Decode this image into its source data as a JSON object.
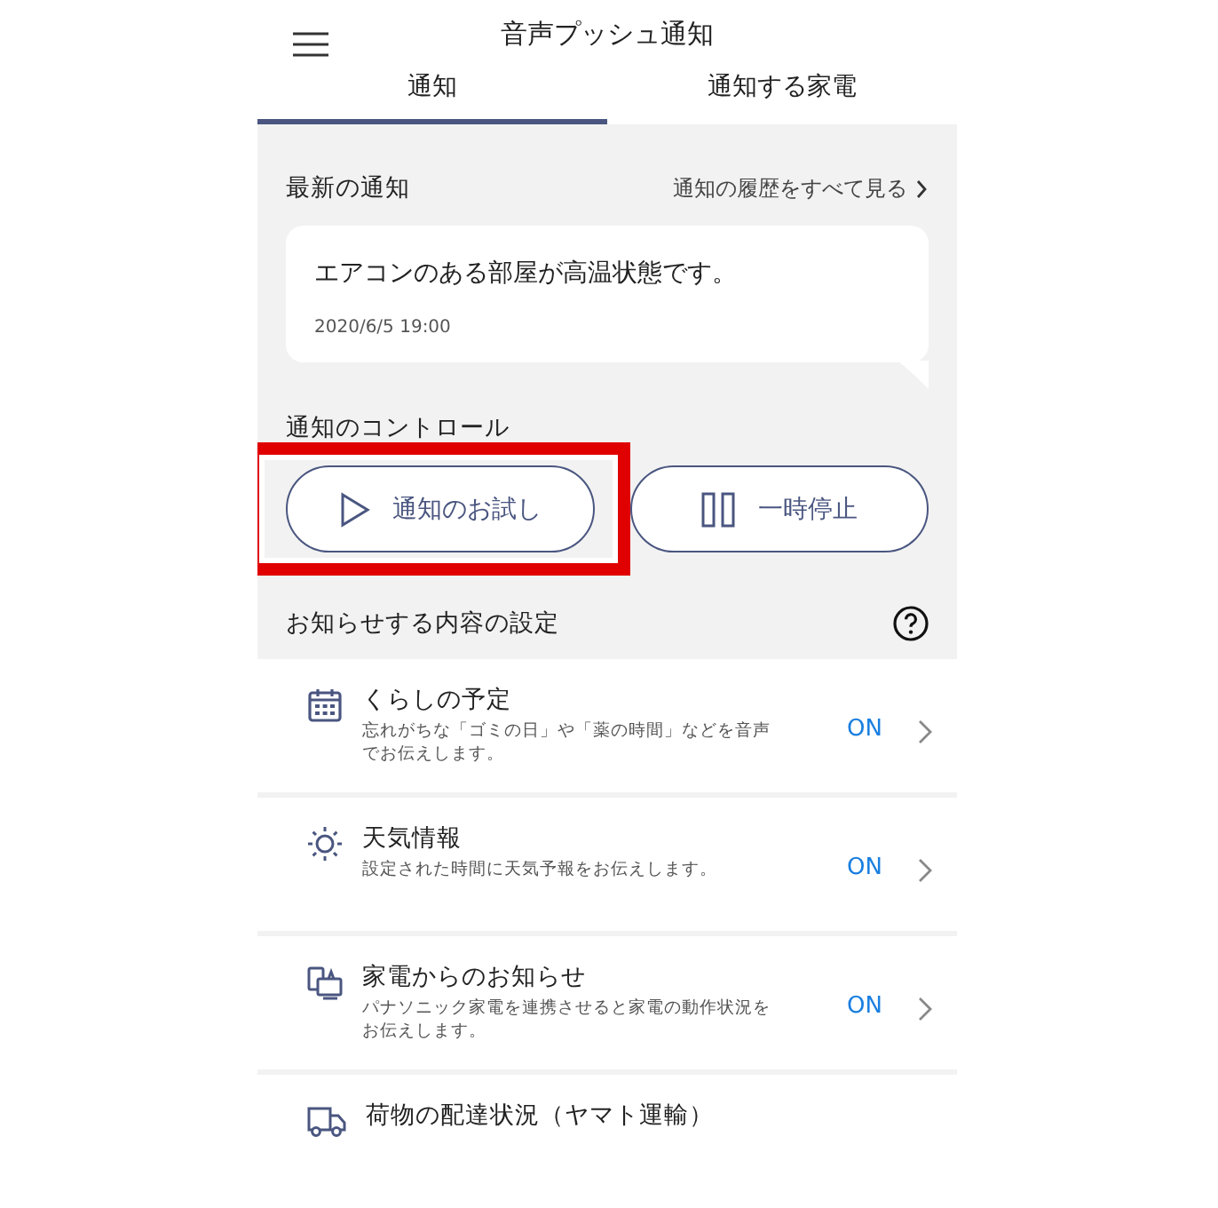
{
  "header": {
    "title": "音声プッシュ通知"
  },
  "tabs": [
    {
      "label": "通知",
      "selected": true
    },
    {
      "label": "通知する家電",
      "selected": false
    }
  ],
  "latest": {
    "heading": "最新の通知",
    "history_link": "通知の履歴をすべて見る",
    "message": "エアコンのある部屋が高温状態です。",
    "time": "2020/6/5 19:00"
  },
  "control": {
    "heading": "通知のコントロール",
    "buttons": [
      {
        "kind": "play",
        "label": "通知のお試し",
        "highlighted": true
      },
      {
        "kind": "pause",
        "label": "一時停止",
        "highlighted": false
      }
    ]
  },
  "settings": {
    "heading": "お知らせする内容の設定",
    "items": [
      {
        "kind": "calendar",
        "title": "くらしの予定",
        "description": "忘れがちな「ゴミの日」や「薬の時間」などを音声でお伝えします。",
        "status": "ON"
      },
      {
        "kind": "sun",
        "title": "天気情報",
        "description": "設定された時間に天気予報をお伝えします。",
        "status": "ON"
      },
      {
        "kind": "appliance",
        "title": "家電からのお知らせ",
        "description": "パナソニック家電を連携させると家電の動作状況をお伝えします。",
        "status": "ON"
      },
      {
        "kind": "truck",
        "title": "荷物の配達状況（ヤマト運輸）"
      }
    ]
  }
}
